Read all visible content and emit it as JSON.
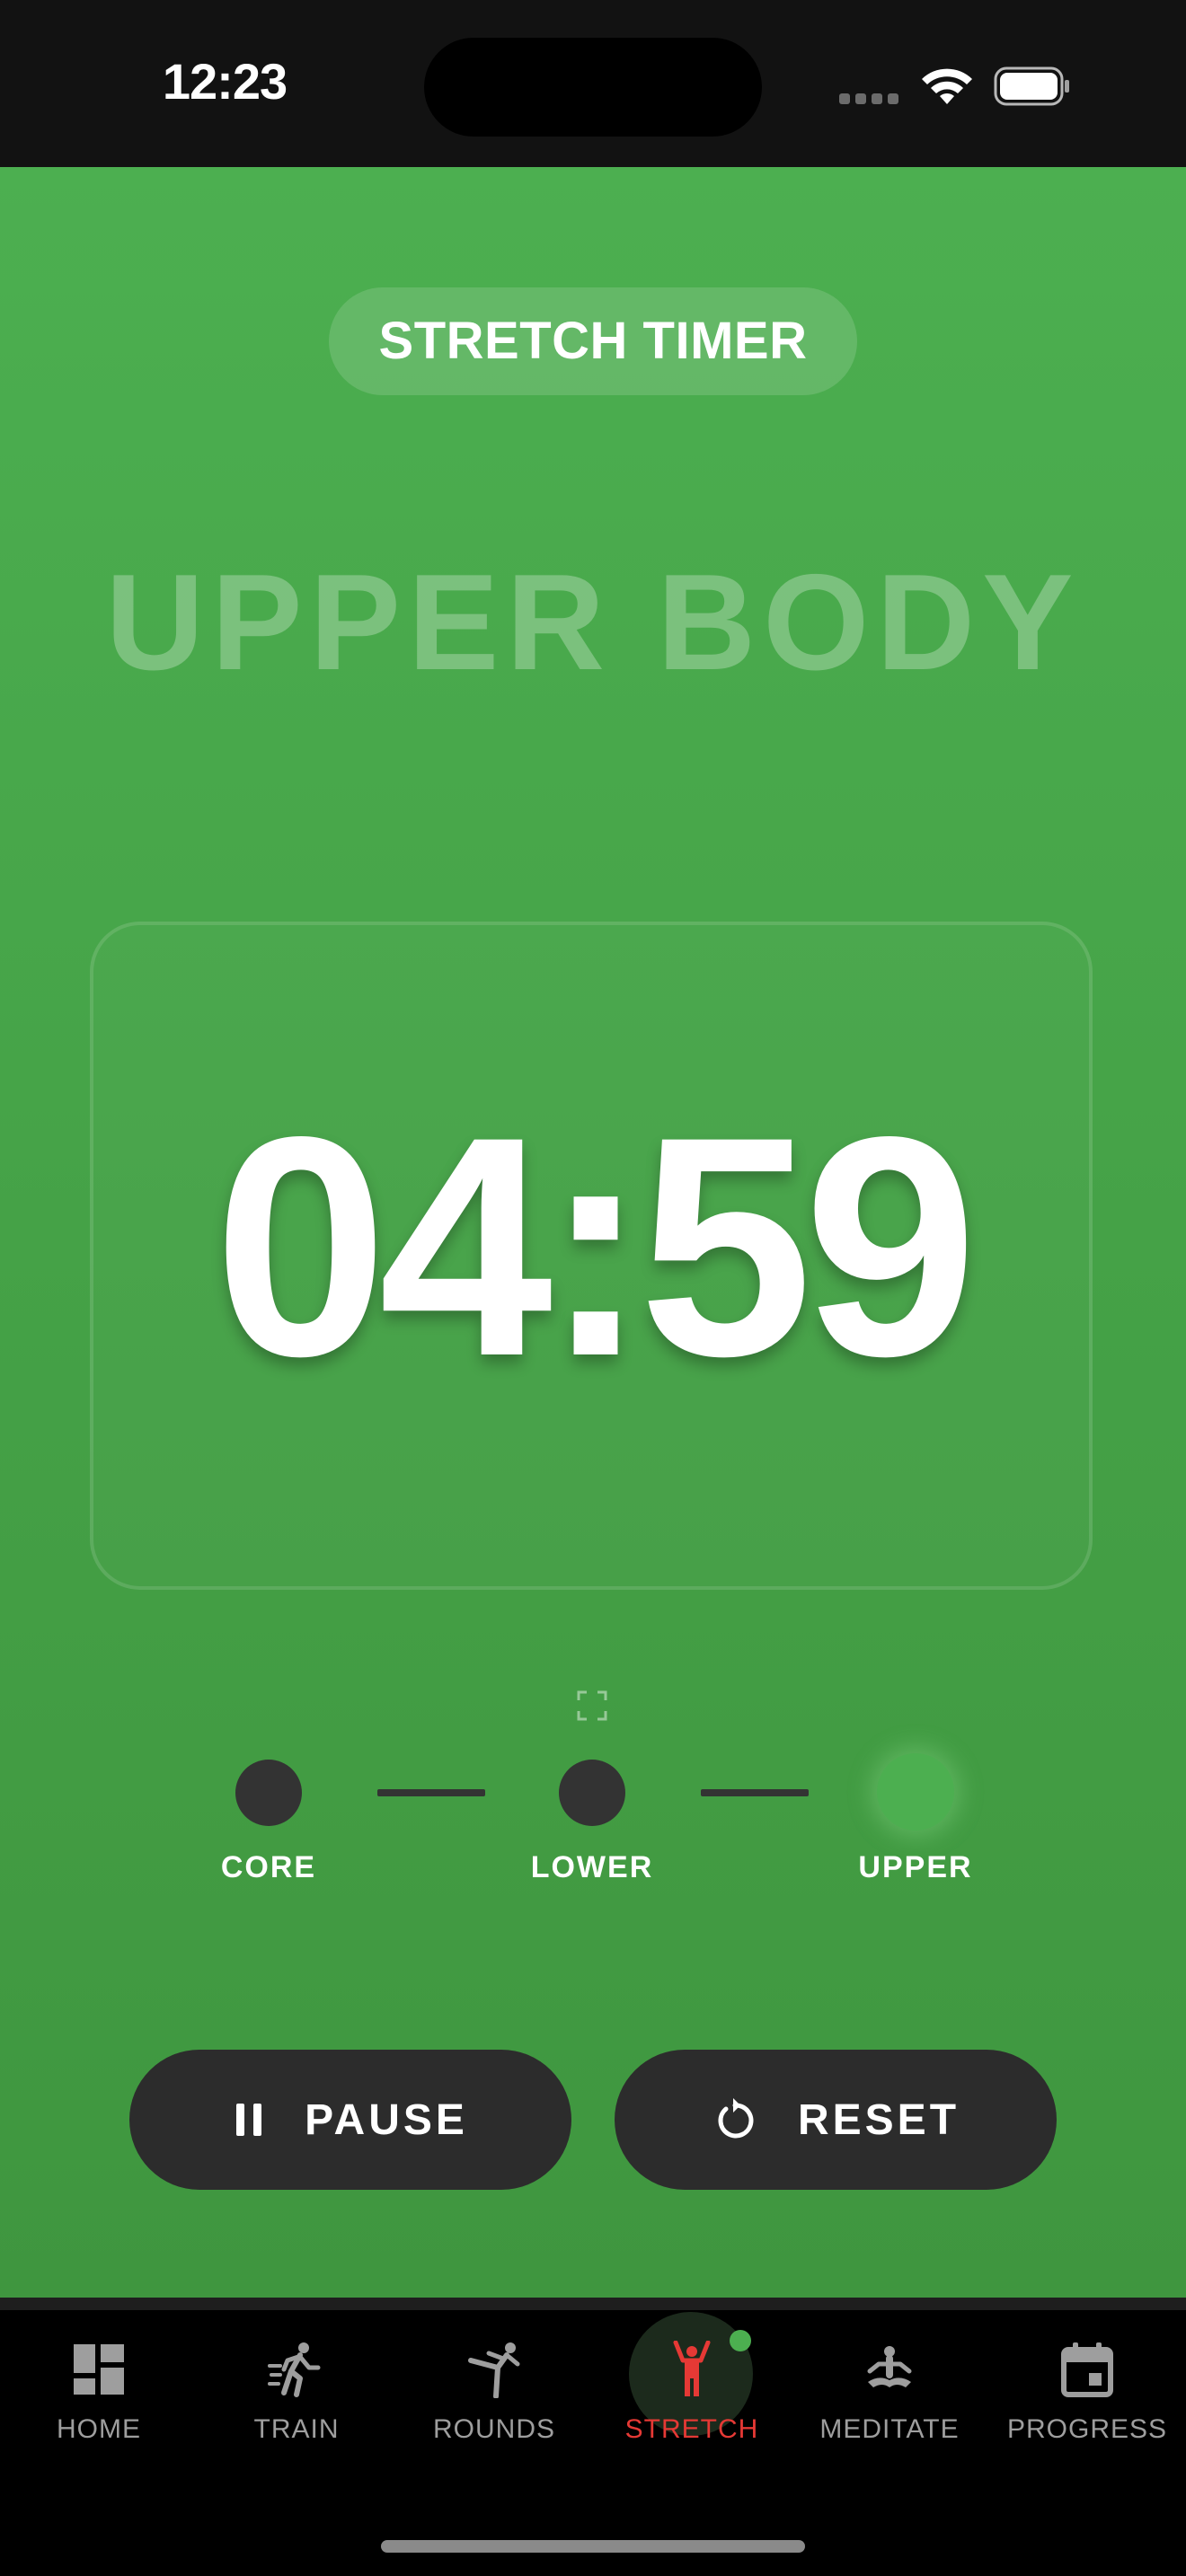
{
  "status_bar": {
    "time": "12:23",
    "icons": [
      "cellular-signal-icon",
      "wifi-icon",
      "battery-icon"
    ]
  },
  "header": {
    "title": "STRETCH TIMER"
  },
  "section": {
    "name": "UPPER BODY"
  },
  "timer": {
    "display": "04:59",
    "fullscreen_icon": "fullscreen-icon"
  },
  "steps": {
    "items": [
      {
        "label": "CORE",
        "active": false
      },
      {
        "label": "LOWER",
        "active": false
      },
      {
        "label": "UPPER",
        "active": true
      }
    ]
  },
  "controls": {
    "pause_label": "PAUSE",
    "reset_label": "RESET",
    "pause_icon": "pause-icon",
    "reset_icon": "reset-icon"
  },
  "tab_bar": {
    "items": [
      {
        "label": "HOME",
        "icon": "dashboard-icon",
        "active": false
      },
      {
        "label": "TRAIN",
        "icon": "running-icon",
        "active": false
      },
      {
        "label": "ROUNDS",
        "icon": "kick-icon",
        "active": false
      },
      {
        "label": "STRETCH",
        "icon": "stretch-icon",
        "active": true
      },
      {
        "label": "MEDITATE",
        "icon": "meditate-icon",
        "active": false
      },
      {
        "label": "PROGRESS",
        "icon": "calendar-icon",
        "active": false
      }
    ]
  },
  "colors": {
    "accent_green": "#4caf50",
    "active_tab": "#e53935",
    "button_bg": "#2c2c2c",
    "inactive": "#9e9e9e"
  }
}
